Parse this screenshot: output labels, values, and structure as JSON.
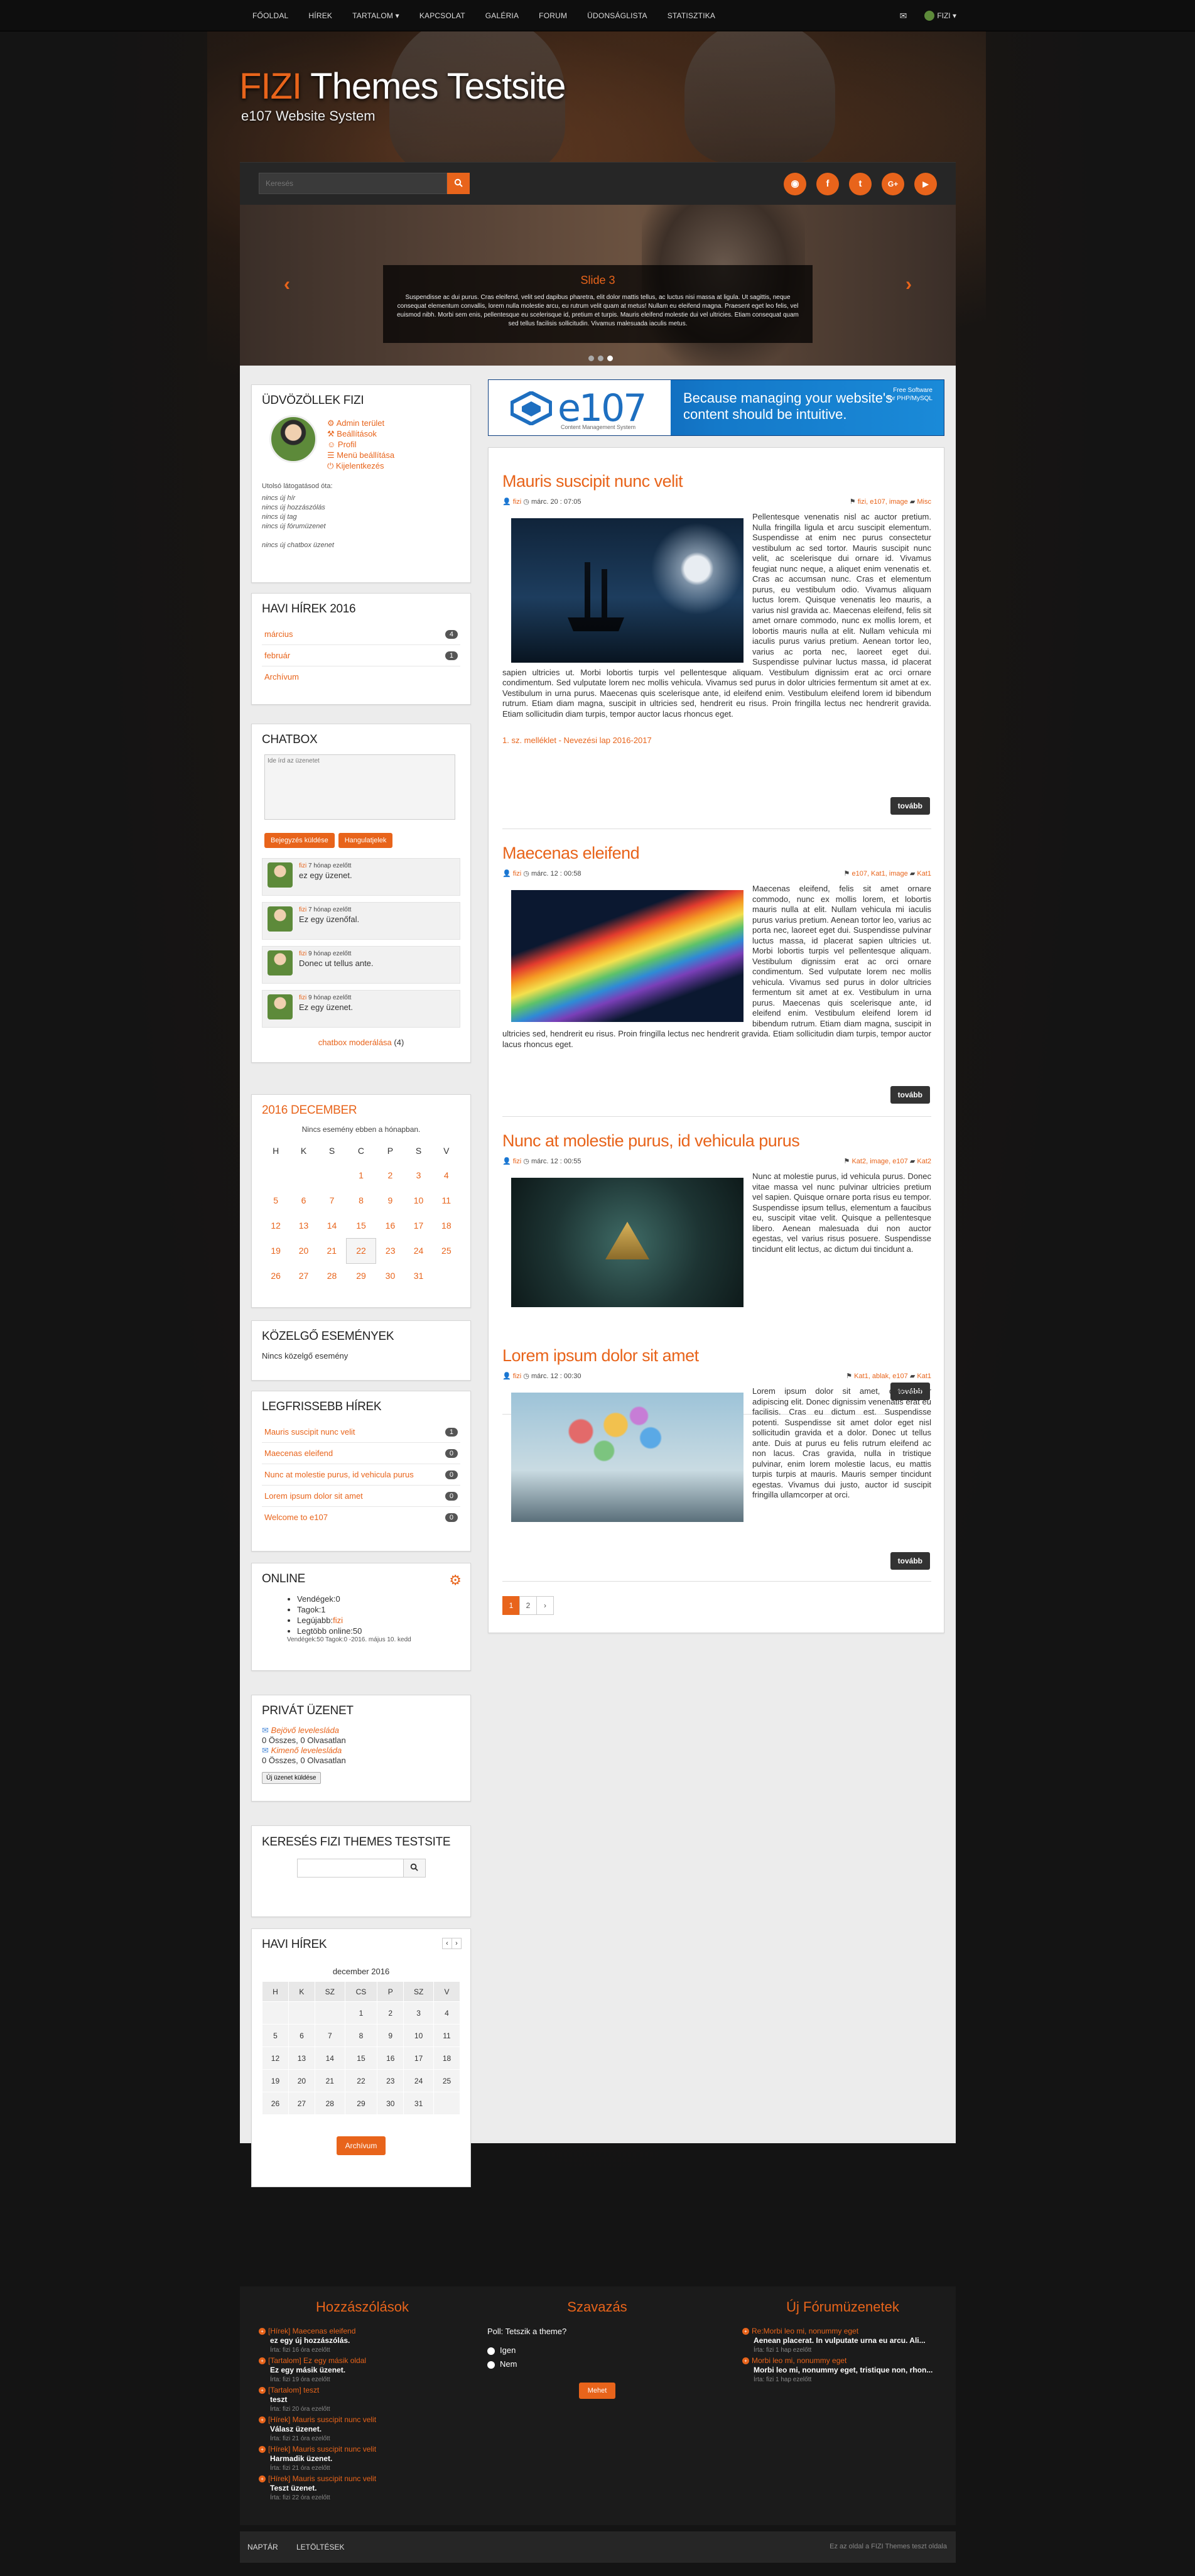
{
  "nav": {
    "items": [
      "FŐOLDAL",
      "HÍREK",
      "TARTALOM ▾",
      "KAPCSOLAT",
      "GALÉRIA",
      "FORUM",
      "ÜDONSÁGLISTA",
      "STATISZTIKA"
    ],
    "user_label": "FIZI ▾"
  },
  "header": {
    "title_brand": "FIZI",
    "title_rest": " Themes Testsite",
    "subtitle": "e107 Website System"
  },
  "search": {
    "placeholder": "Keresés"
  },
  "social": [
    "rss",
    "facebook",
    "twitter",
    "google-plus",
    "youtube"
  ],
  "slider": {
    "title": "Slide 3",
    "text": "Suspendisse ac dui purus. Cras eleifend, velit sed dapibus pharetra, elit dolor mattis tellus, ac luctus nisi massa at ligula. Ut sagittis, neque consequat elementum convallis, lorem nulla molestie arcu, eu rutrum velit quam at metus! Nullam eu eleifend magna. Praesent eget leo felis, vel euismod nibh. Morbi sem enis, pellentesque eu scelerisque id, pretium et turpis. Mauris eleifend molestie dui vel ultricies. Etiam consequat quam sed tellus facilisis sollicitudin. Vivamus malesuada iaculis metus."
  },
  "welcome": {
    "title": "ÜDVÖZÖLLEK FIZI",
    "links": [
      "Admin terület",
      "Beállítások",
      "Profil",
      "Menü beállítása",
      "Kijelentkezés"
    ],
    "last_visit_label": "Utolsó látogatásod óta:",
    "since": [
      "nincs új hír",
      "nincs új hozzászólás",
      "nincs új tag",
      "nincs új fórumüzenet"
    ],
    "chatbox_note": "nincs új chatbox üzenet"
  },
  "monthly_news": {
    "title": "HAVI HÍREK 2016",
    "rows": [
      {
        "label": "március",
        "count": "4"
      },
      {
        "label": "február",
        "count": "1"
      },
      {
        "label": "Archívum",
        "count": ""
      }
    ]
  },
  "chatbox": {
    "title": "CHATBOX",
    "placeholder": "Ide írd az üzenetet",
    "submit": "Bejegyzés küldése",
    "emoticons": "Hangulatjelek",
    "messages": [
      {
        "user": "fizi",
        "time": "7 hónap ezelőtt",
        "text": "ez egy üzenet."
      },
      {
        "user": "fizi",
        "time": "7 hónap ezelőtt",
        "text": "Ez egy üzenőfal."
      },
      {
        "user": "fizi",
        "time": "9 hónap ezelőtt",
        "text": "Donec ut tellus ante."
      },
      {
        "user": "fizi",
        "time": "9 hónap ezelőtt",
        "text": "Ez egy üzenet."
      }
    ],
    "moderate": "chatbox moderálása",
    "moderate_count": "(4)"
  },
  "calendar": {
    "title": "2016 DECEMBER",
    "note": "Nincs esemény ebben a hónapban.",
    "headers": [
      "H",
      "K",
      "S",
      "C",
      "P",
      "S",
      "V"
    ],
    "weeks": [
      [
        "",
        "",
        "",
        "1",
        "2",
        "3",
        "4"
      ],
      [
        "5",
        "6",
        "7",
        "8",
        "9",
        "10",
        "11"
      ],
      [
        "12",
        "13",
        "14",
        "15",
        "16",
        "17",
        "18"
      ],
      [
        "19",
        "20",
        "21",
        "22",
        "23",
        "24",
        "25"
      ],
      [
        "26",
        "27",
        "28",
        "29",
        "30",
        "31",
        ""
      ]
    ]
  },
  "upcoming": {
    "title": "KÖZELGŐ ESEMÉNYEK",
    "text": "Nincs közelgő esemény"
  },
  "latest_news": {
    "title": "LEGFRISSEBB HÍREK",
    "rows": [
      {
        "label": "Mauris suscipit nunc velit",
        "count": "1"
      },
      {
        "label": "Maecenas eleifend",
        "count": "0"
      },
      {
        "label": "Nunc at molestie purus, id vehicula purus",
        "count": "0"
      },
      {
        "label": "Lorem ipsum dolor sit amet",
        "count": "0"
      },
      {
        "label": "Welcome to e107",
        "count": "0"
      }
    ]
  },
  "online": {
    "title": "ONLINE",
    "guests": "Vendégek:0",
    "members": "Tagok:1",
    "newest_label": "Legújabb:",
    "newest": "fizi",
    "max": "Legtöbb online:50",
    "record": "Vendégek:50 Tagok:0 -2016. május 10. kedd"
  },
  "private_msg": {
    "title": "PRIVÁT ÜZENET",
    "inbox": "Bejövő levelesláda",
    "inbox_stat": "0 Összes, 0 Olvasatlan",
    "outbox": "Kimenő levelesláda",
    "outbox_stat": "0 Összes, 0 Olvasatlan",
    "new_btn": "Új üzenet küldése"
  },
  "search_panel": {
    "title": "KERESÉS FIZI THEMES TESTSITE"
  },
  "monthly_cal": {
    "title": "HAVI HÍREK",
    "month": "december 2016",
    "headers": [
      "H",
      "K",
      "SZ",
      "CS",
      "P",
      "SZ",
      "V"
    ],
    "weeks": [
      [
        "",
        "",
        "",
        "1",
        "2",
        "3",
        "4"
      ],
      [
        "5",
        "6",
        "7",
        "8",
        "9",
        "10",
        "11"
      ],
      [
        "12",
        "13",
        "14",
        "15",
        "16",
        "17",
        "18"
      ],
      [
        "19",
        "20",
        "21",
        "22",
        "23",
        "24",
        "25"
      ],
      [
        "26",
        "27",
        "28",
        "29",
        "30",
        "31",
        ""
      ]
    ],
    "archive_btn": "Archívum"
  },
  "banner": {
    "logo": "e107",
    "logo_sub": "Content Management System",
    "slogan_line1": "Because managing your website's",
    "slogan_line2": "content should be intuitive.",
    "free_line1": "Free Software",
    "free_line2": "for PHP/MySQL"
  },
  "articles": [
    {
      "title": "Mauris suscipit nunc velit",
      "author": "fizi",
      "date": "márc. 20 : 07:05",
      "tags": "fizi, e107, image",
      "category": "Misc",
      "text": "Pellentesque venenatis nisl ac auctor pretium. Nulla fringilla ligula et arcu suscipit elementum. Suspendisse at enim nec purus consectetur vestibulum ac sed tortor. Mauris suscipit nunc velit, ac scelerisque dui ornare id. Vivamus feugiat nunc neque, a aliquet enim venenatis et. Cras ac accumsan nunc. Cras et elementum purus, eu vestibulum odio. Vivamus aliquam luctus lorem. Quisque venenatis leo mauris, a varius nisl gravida ac. Maecenas eleifend, felis sit amet ornare commodo, nunc ex mollis lorem, et lobortis mauris nulla at elit. Nullam vehicula mi iaculis purus varius pretium. Aenean tortor leo, varius ac porta nec, laoreet eget dui. Suspendisse pulvinar luctus massa, id placerat sapien ultricies ut. Morbi lobortis turpis vel pellentesque aliquam. Vestibulum dignissim erat ac orci ornare condimentum. Sed vulputate lorem nec mollis vehicula. Vivamus sed purus in dolor ultricies fermentum sit amet at ex. Vestibulum in urna purus. Maecenas quis scelerisque ante, id eleifend enim. Vestibulum eleifend lorem id bibendum rutrum. Etiam diam magna, suscipit in ultricies sed, hendrerit eu risus. Proin fringilla lectus nec hendrerit gravida. Etiam sollicitudin diam turpis, tempor auctor lacus rhoncus eget.",
      "attachment": "1. sz. melléklet - Nevezési lap 2016-2017",
      "more": "tovább"
    },
    {
      "title": "Maecenas eleifend",
      "author": "fizi",
      "date": "márc. 12 : 00:58",
      "tags": "e107, Kat1, image",
      "category": "Kat1",
      "text": "Maecenas eleifend, felis sit amet ornare commodo, nunc ex mollis lorem, et lobortis mauris nulla at elit. Nullam vehicula mi iaculis purus varius pretium. Aenean tortor leo, varius ac porta nec, laoreet eget dui. Suspendisse pulvinar luctus massa, id placerat sapien ultricies ut. Morbi lobortis turpis vel pellentesque aliquam. Vestibulum dignissim erat ac orci ornare condimentum. Sed vulputate lorem nec mollis vehicula. Vivamus sed purus in dolor ultricies fermentum sit amet at ex. Vestibulum in urna purus. Maecenas quis scelerisque ante, id eleifend enim. Vestibulum eleifend lorem id bibendum rutrum. Etiam diam magna, suscipit in ultricies sed, hendrerit eu risus. Proin fringilla lectus nec hendrerit gravida. Etiam sollicitudin diam turpis, tempor auctor lacus rhoncus eget.",
      "more": "tovább"
    },
    {
      "title": "Nunc at molestie purus, id vehicula purus",
      "author": "fizi",
      "date": "márc. 12 : 00:55",
      "tags": "Kat2, image, e107",
      "category": "Kat2",
      "text": "Nunc at molestie purus, id vehicula purus. Donec vitae massa vel nunc pulvinar ultricies pretium vel sapien. Quisque ornare porta risus eu tempor. Suspendisse ipsum tellus, elementum a faucibus eu, suscipit vitae velit. Quisque a pellentesque libero. Aenean malesuada dui non auctor egestas, vel varius risus posuere. Suspendisse tincidunt elit lectus, ac dictum dui tincidunt a.",
      "more": "tovább"
    },
    {
      "title": "Lorem ipsum dolor sit amet",
      "author": "fizi",
      "date": "márc. 12 : 00:30",
      "tags": "Kat1, ablak, e107",
      "category": "Kat1",
      "text": "Lorem ipsum dolor sit amet, consectetur adipiscing elit. Donec dignissim venenatis erat eu facilisis. Cras eu dictum est. Suspendisse potenti. Suspendisse sit amet dolor eget nisl sollicitudin gravida et a dolor. Donec ut tellus ante. Duis at purus eu felis rutrum eleifend ac non lacus. Cras gravida, nulla in tristique pulvinar, enim lorem molestie lacus, eu mattis turpis turpis at mauris. Mauris semper tincidunt egestas. Vivamus dui justo, auctor id suscipit fringilla ullamcorper at orci.",
      "more": "tovább"
    }
  ],
  "pager": {
    "pages": [
      "1",
      "2",
      "›"
    ]
  },
  "footer": {
    "comments_title": "Hozzászólások",
    "comments": [
      {
        "link": "[Hírek] Maecenas eleifend",
        "text": "ez egy új hozzászólás.",
        "meta": "Írta: fizi 16 óra ezelőtt"
      },
      {
        "link": "[Tartalom] Ez egy másik oldal",
        "text": "Ez egy másik üzenet.",
        "meta": "Írta: fizi 19 óra ezelőtt"
      },
      {
        "link": "[Tartalom] teszt",
        "text": "teszt",
        "meta": "Írta: fizi 20 óra ezelőtt"
      },
      {
        "link": "[Hírek] Mauris suscipit nunc velit",
        "text": "Válasz üzenet.",
        "meta": "Írta: fizi 21 óra ezelőtt"
      },
      {
        "link": "[Hírek] Mauris suscipit nunc velit",
        "text": "Harmadik üzenet.",
        "meta": "Írta: fizi 21 óra ezelőtt"
      },
      {
        "link": "[Hírek] Mauris suscipit nunc velit",
        "text": "Teszt üzenet.",
        "meta": "Írta: fizi 22 óra ezelőtt"
      }
    ],
    "poll_title": "Szavazás",
    "poll_question": "Poll: Tetszik a theme?",
    "poll_options": [
      "Igen",
      "Nem"
    ],
    "poll_submit": "Mehet",
    "forum_title": "Új Fórumüzenetek",
    "forum": [
      {
        "link": "Re:Morbi leo mi, nonummy eget",
        "text": "Aenean placerat. In vulputate urna eu arcu. Ali...",
        "meta": "Írta: fizi 1 hap ezelőtt"
      },
      {
        "link": "Morbi leo mi, nonummy eget",
        "text": "Morbi leo mi, nonummy eget, tristique non, rhon...",
        "meta": "Írta: fizi 1 hap ezelőtt"
      }
    ],
    "bottom_links": [
      "NAPTÁR",
      "LETÖLTÉSEK"
    ],
    "copyright": "Ez az oldal a FIZI Themes teszt oldala"
  },
  "colors": {
    "accent": "#e8641b",
    "dark": "#1b1b1b",
    "panel_bg": "#ffffff"
  }
}
